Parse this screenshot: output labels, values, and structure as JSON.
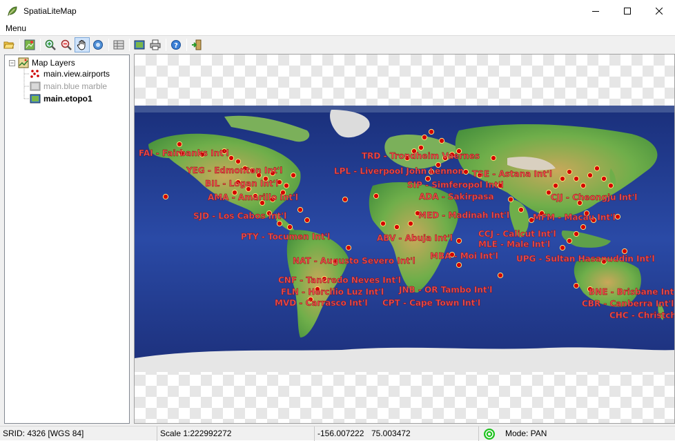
{
  "window": {
    "title": "SpatiaLiteMap",
    "icon": "leaf-map-icon"
  },
  "menu": {
    "items": [
      "Menu"
    ]
  },
  "toolbar": {
    "buttons": [
      {
        "name": "open-folder-icon"
      },
      {
        "name": "add-layer-icon"
      },
      {
        "name": "zoom-in-icon"
      },
      {
        "name": "zoom-out-icon"
      },
      {
        "name": "pan-hand-icon",
        "active": true
      },
      {
        "name": "identify-icon"
      },
      {
        "name": "table-icon"
      },
      {
        "name": "image-icon"
      },
      {
        "name": "print-icon"
      },
      {
        "name": "help-icon"
      },
      {
        "name": "exit-icon"
      }
    ]
  },
  "layers": {
    "root": "Map Layers",
    "items": [
      {
        "label": "main.view.airports",
        "icon": "points-layer-icon",
        "style": "normal"
      },
      {
        "label": "main.blue marble",
        "icon": "raster-layer-icon",
        "style": "disabled"
      },
      {
        "label": "main.etopo1",
        "icon": "raster-layer-icon",
        "style": "bold"
      }
    ]
  },
  "map": {
    "label_color": "#e8504f",
    "point_color": "#d40000",
    "labels": [
      {
        "text": "FAI - Fairbanks Int'l"
      },
      {
        "text": "YEG - Edmonton Int'l"
      },
      {
        "text": "BIL - Logan Int'l"
      },
      {
        "text": "AMA - Amarillo Int'l"
      },
      {
        "text": "SJD - Los Cabos Int'l"
      },
      {
        "text": "PTY - Tocumen Int'l"
      },
      {
        "text": "NAT - Augusto Severo Int'l"
      },
      {
        "text": "CNF - Tancredo Neves Int'l"
      },
      {
        "text": "FLN - Hercilio Luz Int'l"
      },
      {
        "text": "MVD - Carrasco Int'l"
      },
      {
        "text": "TRD - Trondheim Vaernes"
      },
      {
        "text": "LPL - Liverpool John Lennon"
      },
      {
        "text": "SIP - Simferopol Int'l"
      },
      {
        "text": "TSE - Astana Int'l"
      },
      {
        "text": "ADA - Sakirpasa"
      },
      {
        "text": "MED - Madinah Int'l"
      },
      {
        "text": "ABV - Abuja Int'l"
      },
      {
        "text": "MBA - Moi Int'l"
      },
      {
        "text": "JNB - OR Tambo Int'l"
      },
      {
        "text": "CPT - Cape Town Int'l"
      },
      {
        "text": "CCJ - Calicut Int'l"
      },
      {
        "text": "MLE - Male Int'l"
      },
      {
        "text": "CJJ - Cheongju Int'l"
      },
      {
        "text": "MFM - Macau Int'l"
      },
      {
        "text": "UPG - Sultan Hasanuddin Int'l"
      },
      {
        "text": "BNE - Brisbane Int'l"
      },
      {
        "text": "CBR - Canberra Int'l"
      },
      {
        "text": "CHC - Christchurch Int'l"
      }
    ]
  },
  "status": {
    "srid": "SRID: 4326 [WGS 84]",
    "scale": "Scale 1:222992272",
    "lon": "-156.007222",
    "lat": "75.003472",
    "gps_icon": "gps-status-icon",
    "mode": "Mode: PAN"
  }
}
